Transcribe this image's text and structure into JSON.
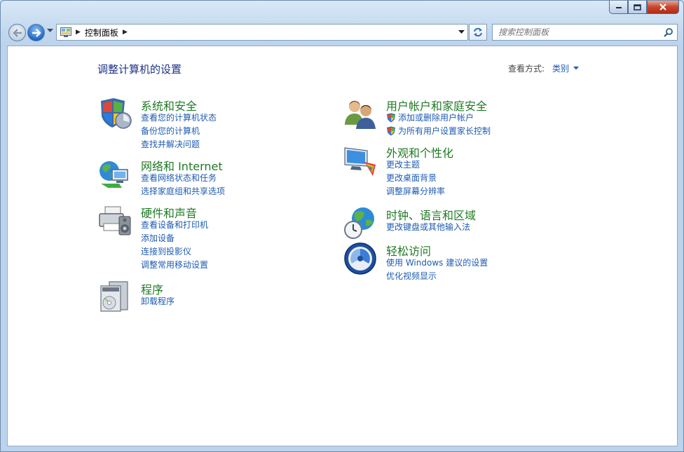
{
  "window": {
    "title_icon": "control-panel-icon"
  },
  "address": {
    "crumbs": [
      "控制面板"
    ],
    "search_placeholder": "搜索控制面板"
  },
  "page": {
    "title": "调整计算机的设置",
    "view_label": "查看方式:",
    "view_value": "类别"
  },
  "categories_left": [
    {
      "title": "系统和安全",
      "icon": "system-security-icon",
      "links": [
        "查看您的计算机状态",
        "备份您的计算机",
        "查找并解决问题"
      ]
    },
    {
      "title": "网络和 Internet",
      "icon": "network-icon",
      "links": [
        "查看网络状态和任务",
        "选择家庭组和共享选项"
      ]
    },
    {
      "title": "硬件和声音",
      "icon": "hardware-sound-icon",
      "links": [
        "查看设备和打印机",
        "添加设备",
        "连接到投影仪",
        "调整常用移动设置"
      ]
    },
    {
      "title": "程序",
      "icon": "programs-icon",
      "links": [
        "卸载程序"
      ]
    }
  ],
  "categories_right": [
    {
      "title": "用户帐户和家庭安全",
      "icon": "user-accounts-icon",
      "links": [
        "添加或删除用户帐户",
        "为所有用户设置家长控制"
      ],
      "shield_links": true
    },
    {
      "title": "外观和个性化",
      "icon": "appearance-icon",
      "links": [
        "更改主题",
        "更改桌面背景",
        "调整屏幕分辨率"
      ]
    },
    {
      "title": "时钟、语言和区域",
      "icon": "clock-language-icon",
      "links": [
        "更改键盘或其他输入法"
      ]
    },
    {
      "title": "轻松访问",
      "icon": "ease-of-access-icon",
      "links": [
        "使用 Windows 建议的设置",
        "优化视频显示"
      ]
    }
  ]
}
